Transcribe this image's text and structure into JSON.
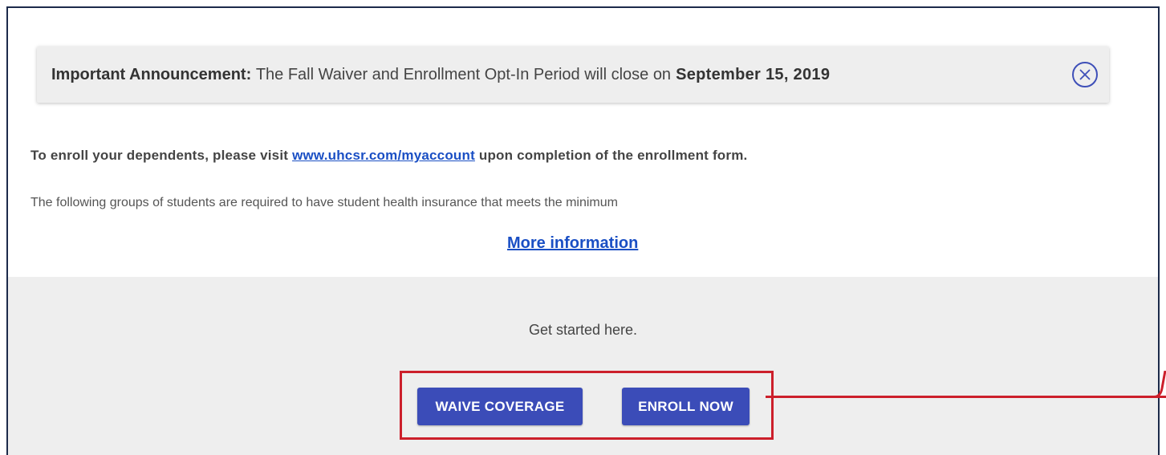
{
  "announcement": {
    "label": "Important Announcement:",
    "message": "The Fall Waiver and Enrollment Opt-In Period will close on",
    "date": "September 15, 2019"
  },
  "dependents": {
    "prefix": "To enroll your dependents, please visit",
    "link_text": "www.uhcsr.com/myaccount",
    "suffix": "upon completion of the enrollment form."
  },
  "groups_text": "The following groups of students are required to have student health insurance that meets the minimum",
  "more_info_label": "More information",
  "get_started_text": "Get started here.",
  "buttons": {
    "waive_label": "WAIVE COVERAGE",
    "enroll_label": "ENROLL NOW"
  },
  "colors": {
    "accent": "#3b4cb8",
    "link": "#1a4fc4",
    "highlight": "#cc1f2b",
    "frame_border": "#1c2b4a"
  },
  "icons": {
    "close": "close-circle-icon"
  }
}
